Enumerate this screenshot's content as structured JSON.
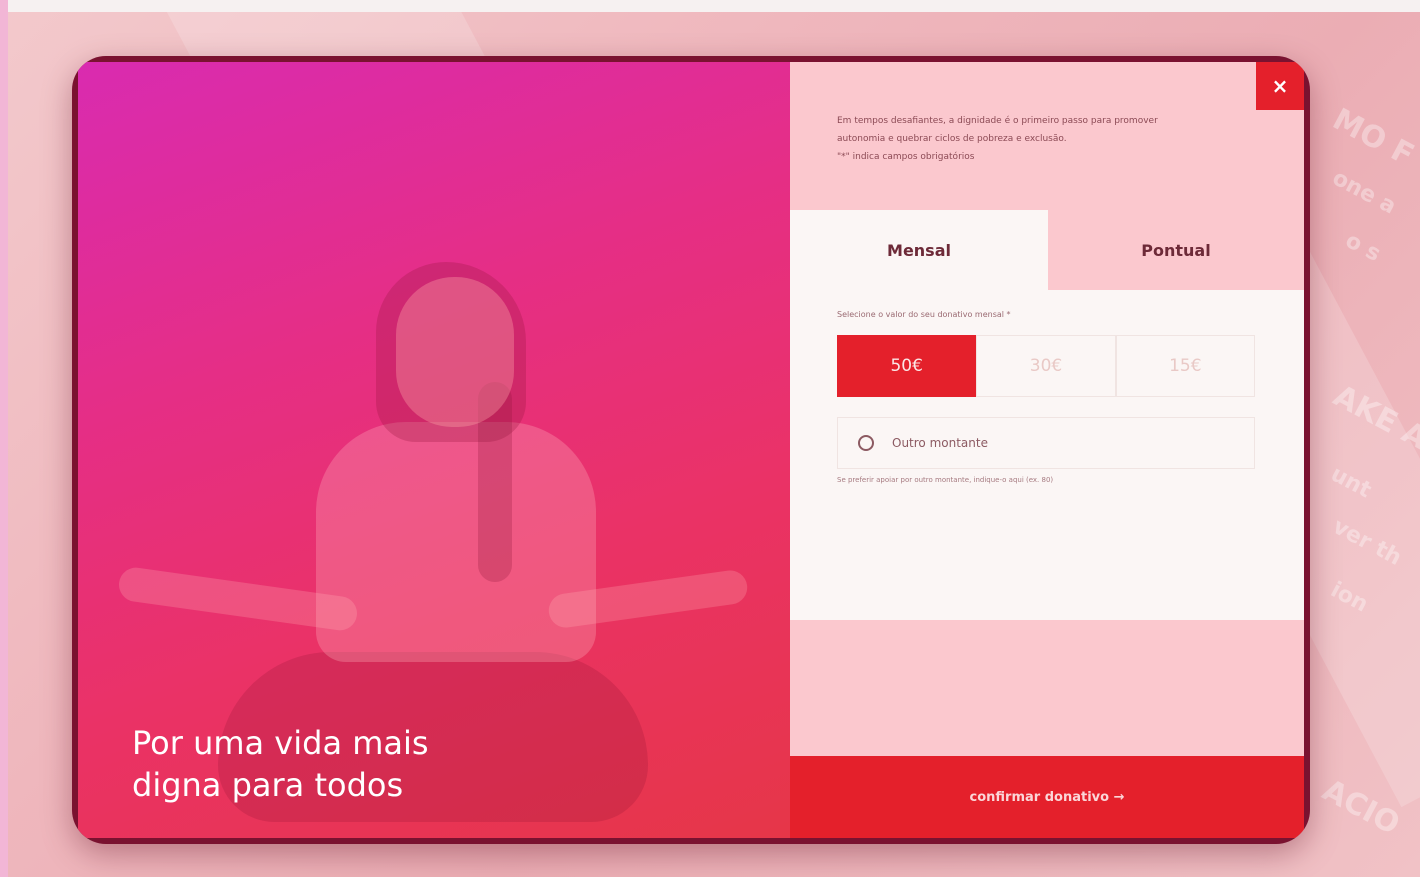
{
  "hero": {
    "caption_line1": "Por uma vida mais",
    "caption_line2": "digna para todos"
  },
  "background": {
    "ghost_text": [
      "MO F",
      "one a",
      "o s",
      "AKE A",
      "unt",
      "ver th",
      "ion",
      "ACIO"
    ]
  },
  "panel": {
    "close_icon": "×",
    "intro_line1": "Em tempos desafiantes, a dignidade é o primeiro passo para promover",
    "intro_line2": "autonomia e quebrar ciclos de pobreza e exclusão.",
    "intro_line3": "\"*\" indica campos obrigatórios",
    "tabs": [
      {
        "label": "Mensal",
        "active": true
      },
      {
        "label": "Pontual",
        "active": false
      }
    ],
    "select_label": "Selecione o valor do seu donativo mensal *",
    "amounts": [
      {
        "label": "50€",
        "selected": true
      },
      {
        "label": "30€",
        "selected": false
      },
      {
        "label": "15€",
        "selected": false
      }
    ],
    "other_amount_label": "Outro montante",
    "hint": "Se preferir apoiar por outro montante, indique-o aqui (ex. 80)",
    "confirm_label": "confirmar donativo →"
  },
  "colors": {
    "accent_red": "#e4202b",
    "hero_magenta": "#d92bb0",
    "panel_pink": "#fbc8ce"
  }
}
